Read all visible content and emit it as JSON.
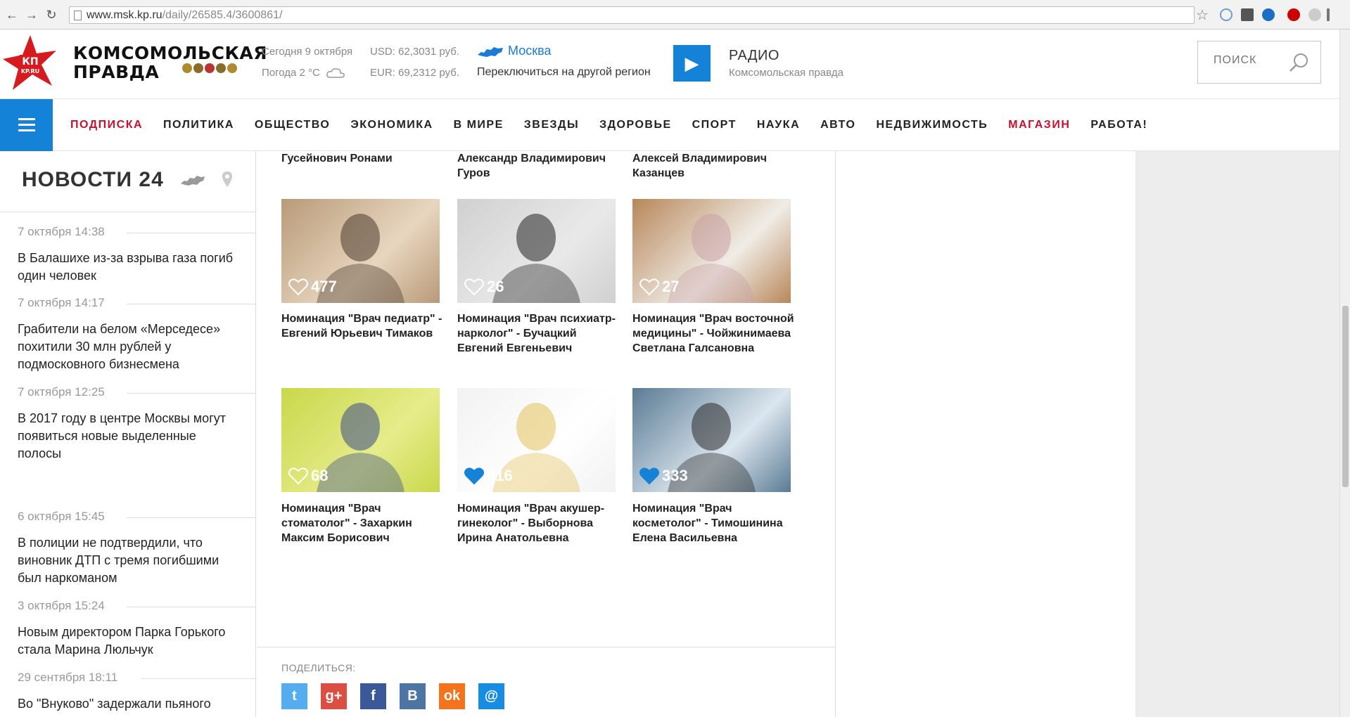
{
  "browser": {
    "url_host": "www.msk.kp.ru",
    "url_path": "/daily/26585.4/3600861/",
    "back_icon": "arrow-left-icon",
    "forward_icon": "arrow-right-icon",
    "reload_icon": "reload-icon",
    "star_icon": "star-icon"
  },
  "header": {
    "logo_text": "КП\nKP.RU",
    "brand_line1": "КОМСОМОЛЬСКАЯ",
    "brand_line2": "ПРАВДА",
    "today": "Сегодня 9 октября",
    "weather": "Погода 2 °C",
    "usd": "USD: 62,3031 руб.",
    "eur": "EUR: 69,2312 руб.",
    "city": "Москва",
    "switch_region": "Переключиться на другой регион",
    "radio_title": "РАДИО",
    "radio_sub": "Комсомольская правда",
    "search_placeholder": "ПОИСК"
  },
  "nav": {
    "items": [
      {
        "label": "ПОДПИСКА",
        "red": true
      },
      {
        "label": "ПОЛИТИКА"
      },
      {
        "label": "ОБЩЕСТВО"
      },
      {
        "label": "ЭКОНОМИКА"
      },
      {
        "label": "В МИРЕ"
      },
      {
        "label": "ЗВЕЗДЫ"
      },
      {
        "label": "ЗДОРОВЬЕ"
      },
      {
        "label": "СПОРТ"
      },
      {
        "label": "НАУКА"
      },
      {
        "label": "АВТО"
      },
      {
        "label": "НЕДВИЖИМОСТЬ"
      },
      {
        "label": "МАГАЗИН",
        "red": true
      },
      {
        "label": "РАБОТА!"
      }
    ]
  },
  "news24": {
    "title": "НОВОСТИ 24",
    "items": [
      {
        "time": "7 октября 14:38",
        "text": "В Балашихе из-за взрыва газа погиб один человек"
      },
      {
        "time": "7 октября 14:17",
        "text": "Грабители на белом «Мерседесе» похитили 30 млн рублей у подмосковного бизнесмена"
      },
      {
        "time": "7 октября 12:25",
        "text": "В 2017 году в центре Москвы могут появиться новые выделенные полосы"
      },
      {
        "time": "6 октября 15:45",
        "text": "В полиции не подтвердили, что виновник ДТП с тремя погибшими был наркоманом"
      },
      {
        "time": "3 октября 15:24",
        "text": "Новым директором Парка Горького стала Марина Люльчук"
      },
      {
        "time": "29 сентября 18:11",
        "text": "Во \"Внуково\" задержали пьяного"
      }
    ]
  },
  "cards": {
    "top_captions": [
      "Гусейнович Ронами",
      "Александр Владимирович Гуров",
      "Алексей Владимирович Казанцев"
    ],
    "items": [
      {
        "likes": "477",
        "caption": "Номинация \"Врач педиатр\" - Евгений Юрьевич Тимаков",
        "liked": false
      },
      {
        "likes": "26",
        "caption": "Номинация \"Врач психиатр-нарколог\" - Бучацкий Евгений Евгеньевич",
        "liked": false
      },
      {
        "likes": "27",
        "caption": "Номинация \"Врач восточной медицины\" - Чойжинимаева Светлана Галсановна",
        "liked": false
      },
      {
        "likes": "68",
        "caption": "Номинация \"Врач стоматолог\" - Захаркин Максим Борисович",
        "liked": false
      },
      {
        "likes": "416",
        "caption": "Номинация \"Врач акушер-гинеколог\" - Выборнова Ирина Анатольевна",
        "liked": true
      },
      {
        "likes": "333",
        "caption": "Номинация \"Врач косметолог\" - Тимошинина Елена Васильевна",
        "liked": true
      }
    ]
  },
  "share": {
    "label": "ПОДЕЛИТЬСЯ:",
    "buttons": [
      {
        "name": "twitter",
        "glyph": "t",
        "color": "#55acee"
      },
      {
        "name": "google-plus",
        "glyph": "g+",
        "color": "#dc4e41"
      },
      {
        "name": "facebook",
        "glyph": "f",
        "color": "#3b5998"
      },
      {
        "name": "vkontakte",
        "glyph": "B",
        "color": "#4c75a3"
      },
      {
        "name": "odnoklassniki",
        "glyph": "ok",
        "color": "#f4731c"
      },
      {
        "name": "moi-mir",
        "glyph": "@",
        "color": "#168de2"
      }
    ]
  },
  "colors": {
    "accent_blue": "#1482d7",
    "nav_red": "#c8102e"
  }
}
